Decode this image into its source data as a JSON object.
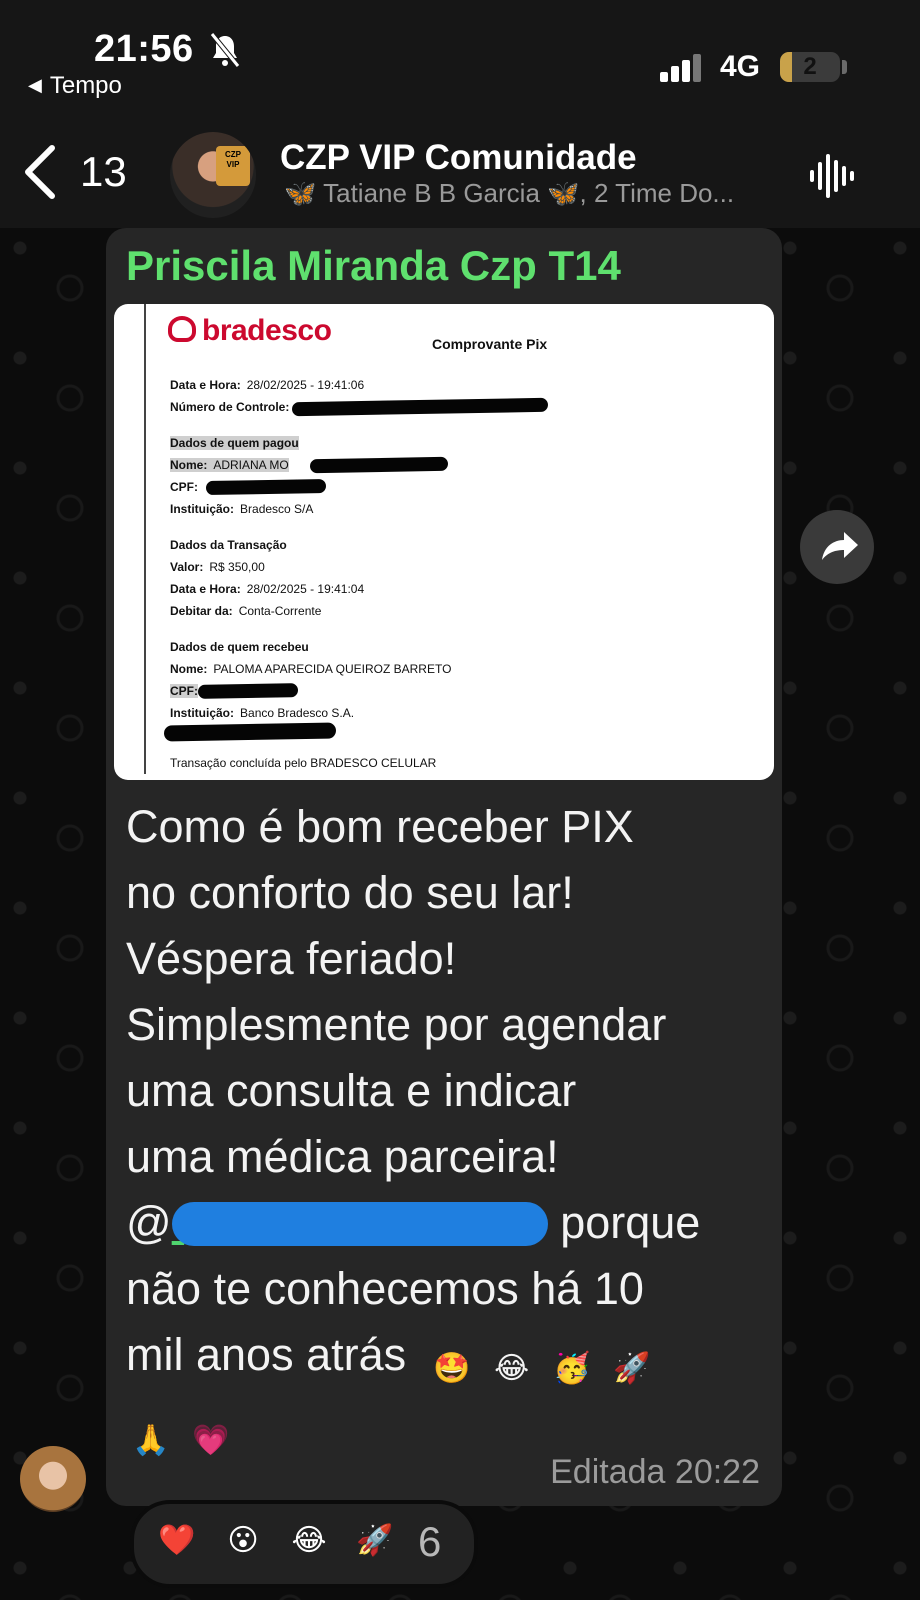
{
  "status_bar": {
    "time": "21:56",
    "back_app_label": "Tempo",
    "network": "4G",
    "battery_level": "2",
    "battery_fraction": 0.2,
    "icons": [
      "bell-slash-icon",
      "signal-bars-icon",
      "battery-icon"
    ]
  },
  "header": {
    "unread_count": "13",
    "title": "CZP VIP Comunidade",
    "subtitle": "🦋 Tatiane B B Garcia 🦋, 2 Time Do...",
    "avatar_badge": "GRUPO VIP CZP",
    "icons": [
      "back-chevron-icon",
      "voice-waveform-icon"
    ]
  },
  "message": {
    "sender": "Priscila Miranda Czp T14",
    "receipt": {
      "bank": "bradesco",
      "doc_title": "Comprovante Pix",
      "datetime_label": "Data e Hora:",
      "datetime": "28/02/2025 - 19:41:06",
      "control_label": "Número de Controle:",
      "payer_section": "Dados de quem pagou",
      "payer_name_label": "Nome:",
      "payer_name": "ADRIANA MO",
      "cpf_label": "CPF:",
      "institution_label": "Instituição:",
      "payer_institution": "Bradesco S/A",
      "transaction_section": "Dados da Transação",
      "value_label": "Valor:",
      "value": "R$ 350,00",
      "tx_datetime": "28/02/2025 - 19:41:04",
      "debit_label": "Debitar da:",
      "debit_account": "Conta-Corrente",
      "receiver_section": "Dados de quem recebeu",
      "receiver_name": "PALOMA APARECIDA QUEIROZ BARRETO",
      "receiver_institution": "Banco Bradesco S.A.",
      "footer": "Transação concluída pelo BRADESCO CELULAR"
    },
    "text_lines": [
      "Como é  bom receber PIX",
      "no conforto do seu lar!",
      "Véspera feriado!",
      "Simplesmente por agendar",
      "uma consulta e indicar",
      "uma médica parceira!"
    ],
    "mention_prefix": "@",
    "after_mention": " porque",
    "line_8": "não te conhecemos há 10",
    "line_9": "mil anos atrás",
    "line_9_emojis": [
      "🤩",
      "😂",
      "🥳",
      "🚀"
    ],
    "line_10_emojis": [
      "🙏",
      "💗"
    ],
    "edited_label": "Editada",
    "time": "20:22"
  },
  "reactions": {
    "emojis": [
      "❤️",
      "😮",
      "😂",
      "🚀"
    ],
    "count": "6"
  },
  "colors": {
    "sender_green": "#5fe06e",
    "bubble": "#262626",
    "bradesco_red": "#cc092f"
  }
}
